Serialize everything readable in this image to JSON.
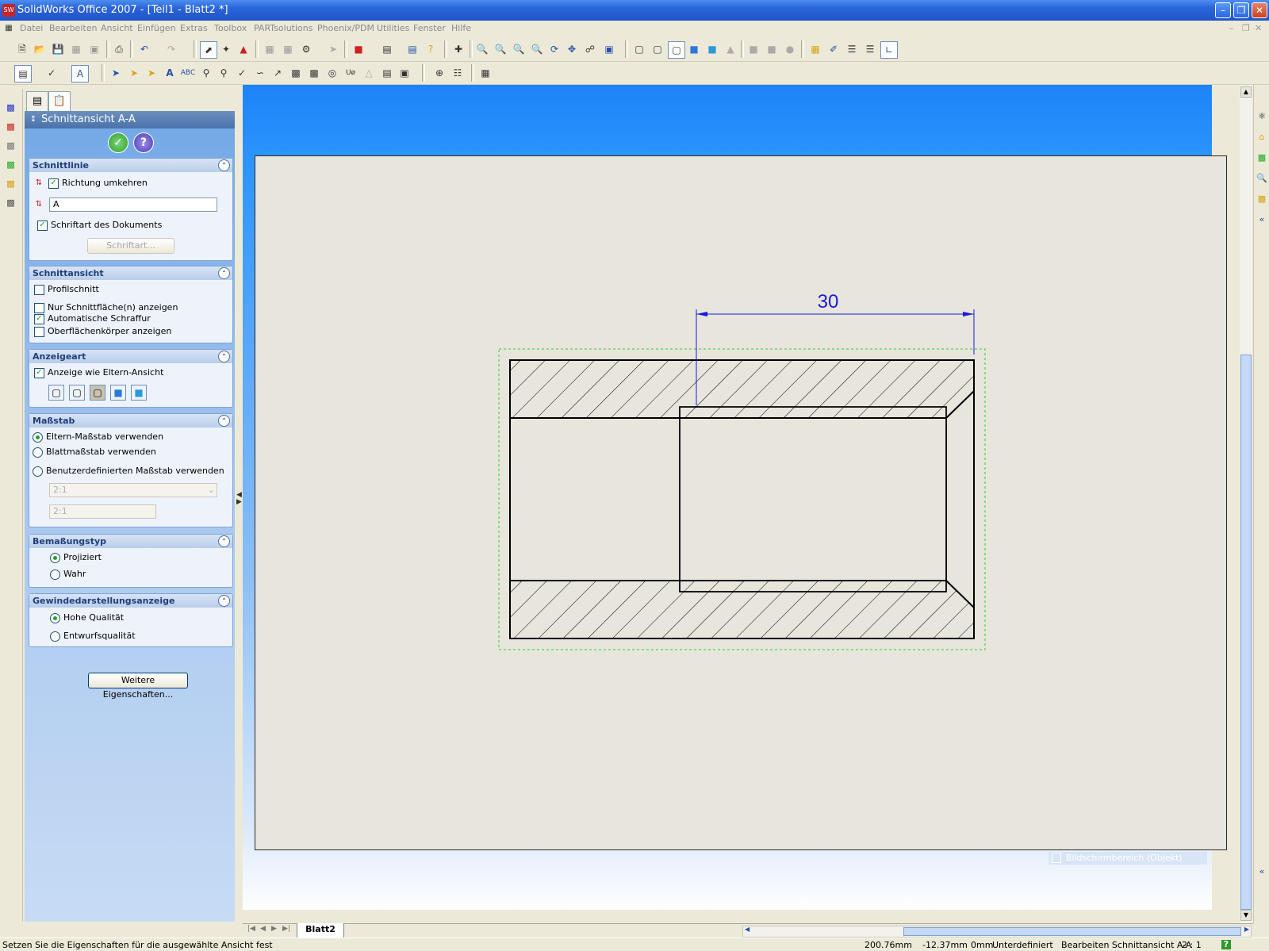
{
  "window": {
    "title": "SolidWorks Office 2007 - [Teil1 - Blatt2 *]",
    "app_icon": "SW"
  },
  "menu": [
    "Datei",
    "Bearbeiten",
    "Ansicht",
    "Einfügen",
    "Extras",
    "Toolbox",
    "PARTsolutions",
    "Phoenix/PDM",
    "Utilities",
    "Fenster",
    "Hilfe"
  ],
  "pm": {
    "title": "Schnittansicht A-A",
    "schnittlinie": {
      "header": "Schnittlinie",
      "richtung": "Richtung umkehren",
      "label_value": "A",
      "schriftart_doc": "Schriftart des Dokuments",
      "schriftart_btn": "Schriftart..."
    },
    "schnittansicht": {
      "header": "Schnittansicht",
      "profilschnitt": "Profilschnitt",
      "nur_flaechen": "Nur Schnittfläche(n) anzeigen",
      "auto_schraffur": "Automatische Schraffur",
      "oberflaechen": "Oberflächenkörper anzeigen"
    },
    "anzeigeart": {
      "header": "Anzeigeart",
      "eltern": "Anzeige wie Eltern-Ansicht"
    },
    "massstab": {
      "header": "Maßstab",
      "eltern": "Eltern-Maßstab verwenden",
      "blatt": "Blattmaßstab verwenden",
      "benutzer": "Benutzerdefinierten Maßstab verwenden",
      "select_value": "2:1",
      "input_value": "2:1"
    },
    "bemassung": {
      "header": "Bemaßungstyp",
      "projiziert": "Projiziert",
      "wahr": "Wahr"
    },
    "gewinde": {
      "header": "Gewindedarstellungsanzeige",
      "hohe": "Hohe Qualität",
      "entwurf": "Entwurfsqualität"
    },
    "weitere_btn": "Weitere Eigenschaften..."
  },
  "drawing": {
    "dimension": "30",
    "tooltip": "Bildschirmbereich (Objekt)"
  },
  "sheet_tab": "Blatt2",
  "status": {
    "message": "Setzen Sie die Eigenschaften für die ausgewählte Ansicht fest",
    "x": "200.76mm",
    "y": "-12.37mm",
    "z": "0mm",
    "state": "Unterdefiniert",
    "mode": "Bearbeiten Schnittansicht A-A",
    "scale": "2 : 1",
    "help": "?"
  }
}
